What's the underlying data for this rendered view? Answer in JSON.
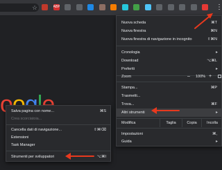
{
  "toolbar": {
    "extensions": [
      {
        "name": "red-square-icon",
        "color": "#c0392b",
        "label": ""
      },
      {
        "name": "abp-icon",
        "color": "#d32f2f",
        "label": "ABP"
      },
      {
        "name": "image-icon",
        "color": "#5f6368",
        "label": ""
      },
      {
        "name": "grid-icon",
        "color": "#5f6368",
        "label": ""
      },
      {
        "name": "blue-circle-icon",
        "color": "#1e88e5",
        "label": ""
      },
      {
        "name": "box-icon",
        "color": "#8d6e63",
        "label": ""
      },
      {
        "name": "orange-icon",
        "color": "#f57c00",
        "label": ""
      },
      {
        "name": "cyan-icon",
        "color": "#26c6da",
        "label": ""
      },
      {
        "name": "green-icon",
        "color": "#43a047",
        "label": ""
      },
      {
        "name": "lightblue-icon",
        "color": "#4fc3f7",
        "label": ""
      },
      {
        "name": "cast-icon",
        "color": "#5f6368",
        "label": ""
      },
      {
        "name": "puzzle-icon",
        "color": "#5f6368",
        "label": ""
      },
      {
        "name": "gear-icon",
        "color": "#5f6368",
        "label": ""
      },
      {
        "name": "tiles-icon",
        "color": "#5f6368",
        "label": ""
      },
      {
        "name": "profile-icon",
        "color": "#e53935",
        "label": ""
      }
    ]
  },
  "logo": {
    "letters": [
      "o",
      "o",
      "g",
      "l",
      "e"
    ],
    "colors": [
      "#ea4335",
      "#fbbc05",
      "#4285f4",
      "#34a853",
      "#ea4335"
    ]
  },
  "main_menu": {
    "new_tab": {
      "label": "Nuova scheda",
      "shortcut": "⌘T"
    },
    "new_window": {
      "label": "Nuova finestra",
      "shortcut": "⌘N"
    },
    "incognito": {
      "label": "Nuova finestra di navigazione in incognito",
      "shortcut": "⇧⌘N"
    },
    "history": {
      "label": "Cronologia"
    },
    "downloads": {
      "label": "Download",
      "shortcut": "⌥⌘L"
    },
    "bookmarks": {
      "label": "Preferiti"
    },
    "zoom": {
      "label": "Zoom",
      "minus": "–",
      "value": "100%",
      "plus": "+"
    },
    "print": {
      "label": "Stampa...",
      "shortcut": "⌘P"
    },
    "cast": {
      "label": "Trasmetti..."
    },
    "find": {
      "label": "Trova...",
      "shortcut": "⌘F"
    },
    "more_tools": {
      "label": "Altri strumenti"
    },
    "edit": {
      "label": "Modifica",
      "cut": "Taglia",
      "copy": "Copia",
      "paste": "Incolla"
    },
    "settings": {
      "label": "Impostazioni",
      "shortcut": "⌘,"
    },
    "help": {
      "label": "Guida"
    }
  },
  "sub_menu": {
    "save_page": {
      "label": "Salva pagina con nome...",
      "shortcut": "⌘S"
    },
    "create_shortcut": {
      "label": "Crea scorciatoia..."
    },
    "clear_data": {
      "label": "Cancella dati di navigazione...",
      "shortcut": "⇧⌘⌫"
    },
    "extensions": {
      "label": "Estensioni"
    },
    "task_manager": {
      "label": "Task Manager"
    },
    "dev_tools": {
      "label": "Strumenti per sviluppatori",
      "shortcut": "⌥⌘I"
    }
  },
  "colors": {
    "arrow": "#e8391e",
    "menu_bg": "#292a2d",
    "page_bg": "#202124"
  }
}
